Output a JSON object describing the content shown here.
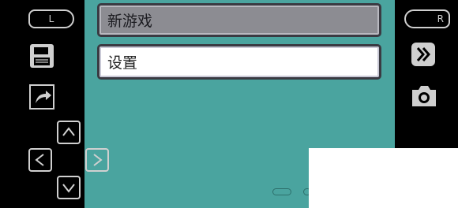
{
  "menu": {
    "items": [
      {
        "label": "新游戏",
        "state": "inactive"
      },
      {
        "label": "设置",
        "state": "selected"
      }
    ]
  },
  "controls": {
    "left_shoulder": "L",
    "right_shoulder": "R",
    "icons": [
      "save-icon",
      "share-icon",
      "fast-forward-icon",
      "camera-icon",
      "menu-icon"
    ],
    "dpad": [
      "up",
      "left",
      "right",
      "down"
    ]
  },
  "colors": {
    "screen_bg": "#4aa49f",
    "selected_bg": "#ffffff",
    "inactive_bg": "#8c8c92",
    "control_stroke": "#d0d0d0"
  }
}
